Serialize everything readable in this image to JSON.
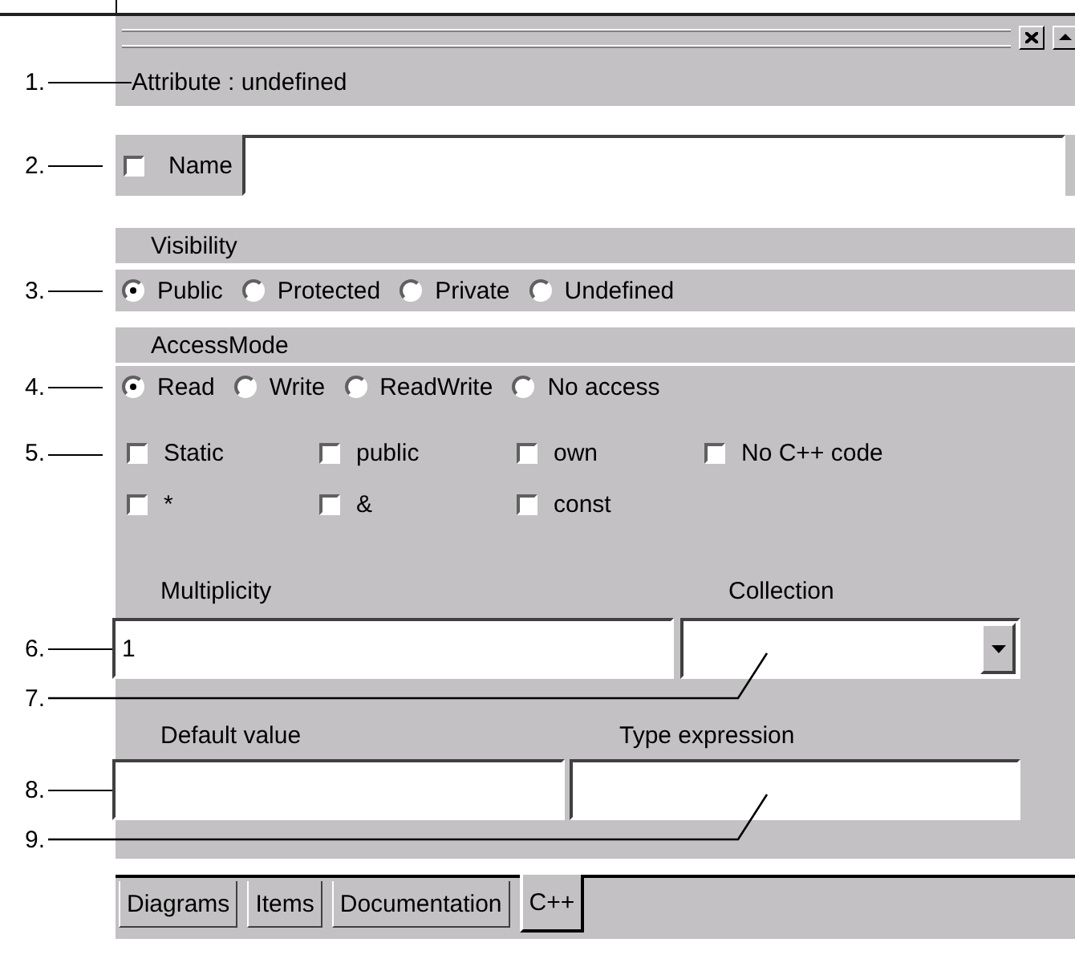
{
  "title_bar": {
    "buttons": [
      {
        "kind": "close"
      },
      {
        "kind": "up"
      }
    ]
  },
  "callouts": [
    "1.",
    "2.",
    "3.",
    "4.",
    "5.",
    "6.",
    "7.",
    "8.",
    "9."
  ],
  "header": "Attribute : undefined",
  "name": {
    "label": "Name",
    "checked": false
  },
  "visibility": {
    "label": "Visibility",
    "options": [
      {
        "label": "Public",
        "selected": true
      },
      {
        "label": "Protected",
        "selected": false
      },
      {
        "label": "Private",
        "selected": false
      },
      {
        "label": "Undefined",
        "selected": false
      }
    ]
  },
  "access_mode": {
    "label": "AccessMode",
    "options": [
      {
        "label": "Read",
        "selected": true
      },
      {
        "label": "Write",
        "selected": false
      },
      {
        "label": "ReadWrite",
        "selected": false
      },
      {
        "label": "No access",
        "selected": false
      }
    ]
  },
  "flags": [
    {
      "label": "Static",
      "checked": false
    },
    {
      "label": "public",
      "checked": false
    },
    {
      "label": "own",
      "checked": false
    },
    {
      "label": "No C++ code",
      "checked": false
    },
    {
      "label": "*",
      "checked": false
    },
    {
      "label": "&",
      "checked": false
    },
    {
      "label": "const",
      "checked": false
    }
  ],
  "multiplicity": {
    "label": "Multiplicity",
    "value": "1"
  },
  "collection": {
    "label": "Collection"
  },
  "default_value": {
    "label": "Default value"
  },
  "type_expression": {
    "label": "Type expression"
  },
  "tabs": [
    {
      "label": "Diagrams",
      "selected": false
    },
    {
      "label": "Items",
      "selected": false
    },
    {
      "label": "Documentation",
      "selected": false
    },
    {
      "label": "C++",
      "selected": true
    }
  ]
}
